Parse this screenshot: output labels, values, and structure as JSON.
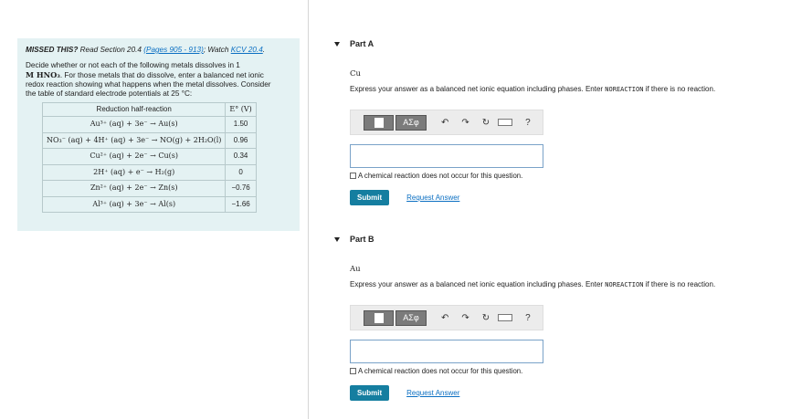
{
  "left": {
    "missed_label": "MISSED THIS?",
    "missed_read": "Read Section 20.4",
    "missed_pages": "(Pages 905 - 913)",
    "missed_sep": "; Watch",
    "missed_kcv": "KCV 20.4",
    "missed_end": ".",
    "problem_line1": "Decide whether or not each of the following metals dissolves in 1",
    "problem_math": "M HNO₃",
    "problem_line2": ". For those metals that do dissolve, enter a balanced net ionic",
    "problem_line3": "redox reaction showing what happens when the metal dissolves. Consider",
    "problem_line4": "the table of standard electrode potentials at 25 °C:",
    "table": {
      "headers": [
        "Reduction half-reaction",
        "E° (V)"
      ],
      "rows": [
        [
          "Au³⁺ (aq) + 3e⁻ → Au(s)",
          "1.50"
        ],
        [
          "NO₃⁻ (aq) + 4H⁺ (aq) + 3e⁻ → NO(g) + 2H₂O(l)",
          "0.96"
        ],
        [
          "Cu²⁺ (aq) + 2e⁻ → Cu(s)",
          "0.34"
        ],
        [
          "2H⁺ (aq) + e⁻ → H₂(g)",
          "0"
        ],
        [
          "Zn²⁺ (aq) + 2e⁻ → Zn(s)",
          "−0.76"
        ],
        [
          "Al³⁺ (aq) + 3e⁻ → Al(s)",
          "−1.66"
        ]
      ]
    }
  },
  "parts": [
    {
      "title": "Part A",
      "metal": "Cu",
      "instruction_pre": "Express your answer as a balanced net ionic equation including phases. Enter",
      "instruction_code": "NOREACTION",
      "instruction_post": "if there is no reaction.",
      "toolbar": {
        "greek": "ΑΣφ",
        "undo": "↶",
        "redo": "↷",
        "reset": "↻",
        "help": "?"
      },
      "answer_value": "",
      "no_reaction_label": "A chemical reaction does not occur for this question.",
      "submit_label": "Submit",
      "request_label": "Request Answer"
    },
    {
      "title": "Part B",
      "metal": "Au",
      "instruction_pre": "Express your answer as a balanced net ionic equation including phases. Enter",
      "instruction_code": "NOREACTION",
      "instruction_post": "if there is no reaction.",
      "toolbar": {
        "greek": "ΑΣφ",
        "undo": "↶",
        "redo": "↷",
        "reset": "↻",
        "help": "?"
      },
      "answer_value": "",
      "no_reaction_label": "A chemical reaction does not occur for this question.",
      "submit_label": "Submit",
      "request_label": "Request Answer"
    }
  ]
}
